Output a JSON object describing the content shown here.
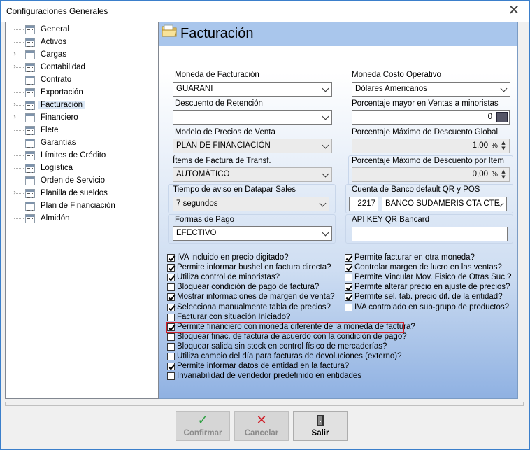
{
  "window": {
    "title": "Configuraciones Generales",
    "close_glyph": "✕"
  },
  "tree": {
    "items": [
      {
        "label": "General",
        "expandable": false,
        "selected": false
      },
      {
        "label": "Activos",
        "expandable": false,
        "selected": false
      },
      {
        "label": "Cargas",
        "expandable": true,
        "selected": false
      },
      {
        "label": "Contabilidad",
        "expandable": true,
        "selected": false
      },
      {
        "label": "Contrato",
        "expandable": false,
        "selected": false
      },
      {
        "label": "Exportación",
        "expandable": false,
        "selected": false
      },
      {
        "label": "Facturación",
        "expandable": true,
        "selected": true
      },
      {
        "label": "Financiero",
        "expandable": true,
        "selected": false
      },
      {
        "label": "Flete",
        "expandable": false,
        "selected": false
      },
      {
        "label": "Garantías",
        "expandable": false,
        "selected": false
      },
      {
        "label": "Límites de Crédito",
        "expandable": false,
        "selected": false
      },
      {
        "label": "Logística",
        "expandable": false,
        "selected": false
      },
      {
        "label": "Orden de Servicio",
        "expandable": false,
        "selected": false
      },
      {
        "label": "Planilla de sueldos",
        "expandable": true,
        "selected": false
      },
      {
        "label": "Plan de Financiación",
        "expandable": false,
        "selected": false
      },
      {
        "label": "Almidón",
        "expandable": false,
        "selected": false
      }
    ]
  },
  "panel": {
    "title": "Facturación",
    "moneda_facturacion": {
      "label": "Moneda de Facturación",
      "value": "GUARANI"
    },
    "descuento_retencion": {
      "label": "Descuento de Retención",
      "value": ""
    },
    "modelo_precios": {
      "label": "Modelo de Precios de Venta",
      "value": "PLAN DE FINANCIACIÓN"
    },
    "items_factura": {
      "label": "Ítems de Factura de Transf.",
      "value": "AUTOMÁTICO"
    },
    "tiempo_aviso": {
      "label": "Tiempo de aviso en Datapar Sales",
      "value": "7 segundos"
    },
    "formas_pago": {
      "label": "Formas de Pago",
      "value": "EFECTIVO"
    },
    "moneda_costo": {
      "label": "Moneda Costo Operativo",
      "value": "Dólares Americanos"
    },
    "pct_mayor_ventas": {
      "label": "Porcentaje mayor en Ventas a minoristas",
      "value": "0"
    },
    "pct_max_desc_global": {
      "label": "Porcentaje Máximo de Descuento Global",
      "value": "1,00",
      "unit": "%"
    },
    "pct_max_desc_item": {
      "label": "Porcentaje Máximo de Descuento por Item",
      "value": "0,00",
      "unit": "%"
    },
    "cuenta_banco": {
      "label": "Cuenta de Banco default QR y POS",
      "code": "2217",
      "value": "BANCO SUDAMERIS CTA CTE"
    },
    "api_key": {
      "label": "API KEY QR Bancard",
      "value": ""
    },
    "checks_left": [
      {
        "label": "IVA incluido en precio digitado?",
        "checked": true
      },
      {
        "label": "Permite informar bushel en factura directa?",
        "checked": true
      },
      {
        "label": "Utiliza control de minoristas?",
        "checked": true
      },
      {
        "label": "Bloquear condición de pago de factura?",
        "checked": false
      },
      {
        "label": "Mostrar informaciones de margen de venta?",
        "checked": true
      },
      {
        "label": "Selecciona manualmente tabla de precios?",
        "checked": true
      },
      {
        "label": "Facturar con situación Iniciado?",
        "checked": false
      },
      {
        "label": "Permite financiero con moneda diferente de la moneda de factura?",
        "checked": true
      },
      {
        "label": "Bloquear finac. de factura de acuerdo con la condición de pago?",
        "checked": false
      },
      {
        "label": "Bloquear salida sin stock en control físico de mercaderías?",
        "checked": false
      },
      {
        "label": "Utiliza cambio del día para facturas de devoluciones (externo)?",
        "checked": false
      },
      {
        "label": "Permite  informar datos de entidad en la factura?",
        "checked": true
      },
      {
        "label": "Invariabilidad de vendedor predefinido en entidades",
        "checked": false
      }
    ],
    "checks_right": [
      {
        "label": "Permite facturar en otra moneda?",
        "checked": true
      },
      {
        "label": "Controlar margen de lucro en las ventas?",
        "checked": true
      },
      {
        "label": "Permite Vincular Mov. Fisico de Otras Suc.?",
        "checked": false
      },
      {
        "label": "Permite alterar precio en ajuste de precios?",
        "checked": true
      },
      {
        "label": "Permite sel. tab. precio dif. de la entidad?",
        "checked": true
      },
      {
        "label": "IVA controlado en sub-grupo de productos?",
        "checked": false
      }
    ]
  },
  "buttons": {
    "confirm": {
      "label": "Confirmar",
      "icon": "✓"
    },
    "cancel": {
      "label": "Cancelar",
      "icon": "✕"
    },
    "exit": {
      "label": "Salir"
    }
  },
  "colors": {
    "highlight": "#d0202a",
    "panel_header": "#a9c6ec",
    "confirm_icon": "#2ea043",
    "cancel_icon": "#d0202a"
  }
}
